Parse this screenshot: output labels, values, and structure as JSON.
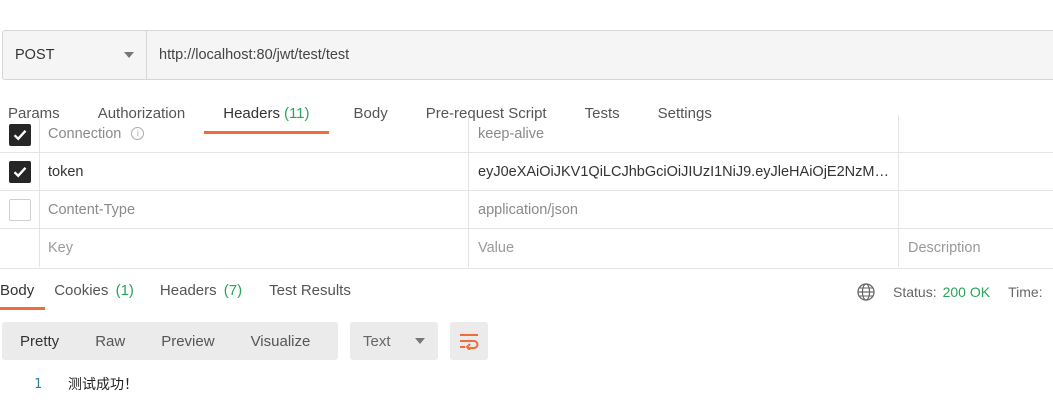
{
  "request": {
    "method": "POST",
    "url": "http://localhost:80/jwt/test/test"
  },
  "request_tabs": [
    {
      "label": "Params",
      "count": ""
    },
    {
      "label": "Authorization",
      "count": ""
    },
    {
      "label": "Headers",
      "count": "(11)"
    },
    {
      "label": "Body",
      "count": ""
    },
    {
      "label": "Pre-request Script",
      "count": ""
    },
    {
      "label": "Tests",
      "count": ""
    },
    {
      "label": "Settings",
      "count": ""
    }
  ],
  "headers_table": {
    "rows": [
      {
        "key": "Connection",
        "value": "keep-alive",
        "description": "",
        "checked": true
      },
      {
        "key": "token",
        "value": "eyJ0eXAiOiJKV1QiLCJhbGciOiJIUzI1NiJ9.eyJleHAiOjE2NzM1...",
        "description": "",
        "checked": true
      },
      {
        "key": "Content-Type",
        "value": "application/json",
        "description": "",
        "checked": false
      }
    ],
    "placeholder": {
      "key": "Key",
      "value": "Value",
      "description": "Description"
    }
  },
  "response_tabs": [
    {
      "label": "Body",
      "count": ""
    },
    {
      "label": "Cookies",
      "count": "(1)"
    },
    {
      "label": "Headers",
      "count": "(7)"
    },
    {
      "label": "Test Results",
      "count": ""
    }
  ],
  "response_status": {
    "status_label": "Status:",
    "status_value": "200 OK",
    "time_label": "Time:"
  },
  "response_toolbar": {
    "formats": [
      "Pretty",
      "Raw",
      "Preview",
      "Visualize"
    ],
    "type": "Text"
  },
  "response_body": {
    "lines": [
      {
        "number": "1",
        "text": "测试成功！"
      }
    ]
  },
  "colors": {
    "accent": "#f26b3a",
    "success": "#26a65b",
    "line_number": "#2b7fa0"
  },
  "icons": [
    "chevron-down-icon",
    "info-icon",
    "checkmark-icon",
    "globe-icon",
    "wrap-lines-icon"
  ]
}
